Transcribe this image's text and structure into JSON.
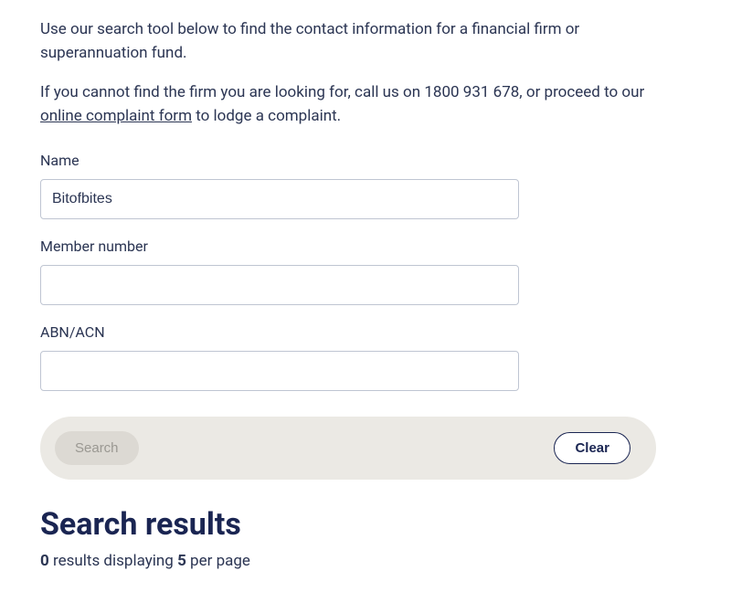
{
  "intro": "Use our search tool below to find the contact information for a financial firm or superannuation fund.",
  "info_prefix": "If you cannot find the firm you are looking for, call us on 1800 931 678, or proceed to our ",
  "info_link": "online complaint form",
  "info_suffix": " to lodge a complaint.",
  "fields": {
    "name": {
      "label": "Name",
      "value": "Bitofbites"
    },
    "member_number": {
      "label": "Member number",
      "value": ""
    },
    "abn_acn": {
      "label": "ABN/ACN",
      "value": ""
    }
  },
  "buttons": {
    "search": "Search",
    "clear": "Clear"
  },
  "results": {
    "heading": "Search results",
    "count": "0",
    "results_word": " results displaying ",
    "per_page": "5",
    "per_page_suffix": " per page"
  }
}
